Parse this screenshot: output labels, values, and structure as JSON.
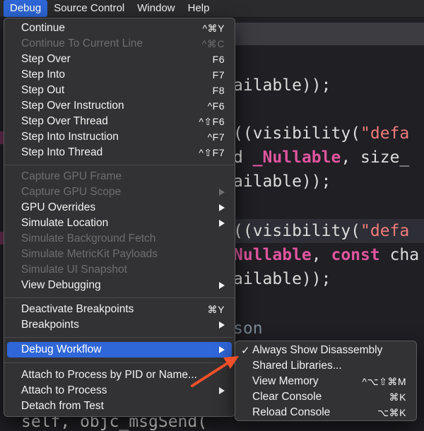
{
  "menubar": {
    "items": [
      {
        "label": "Debug",
        "active": true
      },
      {
        "label": "Source Control",
        "active": false
      },
      {
        "label": "Window",
        "active": false
      },
      {
        "label": "Help",
        "active": false
      }
    ]
  },
  "editor": {
    "lines": [
      {
        "text": "ailable));"
      },
      {
        "pre": "((visibility(",
        "str": "\"defa"
      },
      {
        "pre": "d ",
        "kw": "_Nullable",
        "post": ", size_"
      },
      {
        "text": "ailable));"
      },
      {
        "pre": "((visibility(",
        "str": "\"defa"
      },
      {
        "kw": "Nullable",
        "post": ", ",
        "kw2": "const",
        "post2": " cha"
      },
      {
        "text": "ailable));"
      },
      {
        "comment": "son"
      },
      {
        "text": "self, objc_msgSend("
      }
    ]
  },
  "debug_menu": {
    "groups": [
      [
        {
          "label": "Continue",
          "shortcut": "^⌘Y",
          "disabled": false
        },
        {
          "label": "Continue To Current Line",
          "shortcut": "^⌘C",
          "disabled": true
        },
        {
          "label": "Step Over",
          "shortcut": "F6",
          "disabled": false
        },
        {
          "label": "Step Into",
          "shortcut": "F7",
          "disabled": false
        },
        {
          "label": "Step Out",
          "shortcut": "F8",
          "disabled": false
        },
        {
          "label": "Step Over Instruction",
          "shortcut": "^F6",
          "disabled": false
        },
        {
          "label": "Step Over Thread",
          "shortcut": "^⇧F6",
          "disabled": false
        },
        {
          "label": "Step Into Instruction",
          "shortcut": "^F7",
          "disabled": false
        },
        {
          "label": "Step Into Thread",
          "shortcut": "^⇧F7",
          "disabled": false
        }
      ],
      [
        {
          "label": "Capture GPU Frame",
          "disabled": true
        },
        {
          "label": "Capture GPU Scope",
          "disabled": true,
          "submenu": true
        },
        {
          "label": "GPU Overrides",
          "disabled": false,
          "submenu": true
        },
        {
          "label": "Simulate Location",
          "disabled": false,
          "submenu": true
        },
        {
          "label": "Simulate Background Fetch",
          "disabled": true
        },
        {
          "label": "Simulate MetricKit Payloads",
          "disabled": true
        },
        {
          "label": "Simulate UI Snapshot",
          "disabled": true
        },
        {
          "label": "View Debugging",
          "disabled": false,
          "submenu": true
        }
      ],
      [
        {
          "label": "Deactivate Breakpoints",
          "shortcut": "⌘Y",
          "disabled": false
        },
        {
          "label": "Breakpoints",
          "disabled": false,
          "submenu": true
        }
      ],
      [
        {
          "label": "Debug Workflow",
          "disabled": false,
          "submenu": true,
          "selected": true
        }
      ],
      [
        {
          "label": "Attach to Process by PID or Name...",
          "disabled": false
        },
        {
          "label": "Attach to Process",
          "disabled": false,
          "submenu": true
        },
        {
          "label": "Detach from Test",
          "disabled": false
        }
      ]
    ]
  },
  "workflow_submenu": {
    "items": [
      {
        "label": "Always Show Disassembly",
        "checked": true,
        "shortcut": ""
      },
      {
        "label": "Shared Libraries...",
        "checked": false,
        "shortcut": ""
      },
      {
        "label": "View Memory",
        "checked": false,
        "shortcut": "^⌥⇧⌘M"
      },
      {
        "label": "Clear Console",
        "checked": false,
        "shortcut": "⌘K"
      },
      {
        "label": "Reload Console",
        "checked": false,
        "shortcut": "⌥⌘K"
      }
    ],
    "check_glyph": "✓"
  },
  "colors": {
    "accent": "#2f66d8",
    "annotation_arrow": "#f0502a"
  }
}
